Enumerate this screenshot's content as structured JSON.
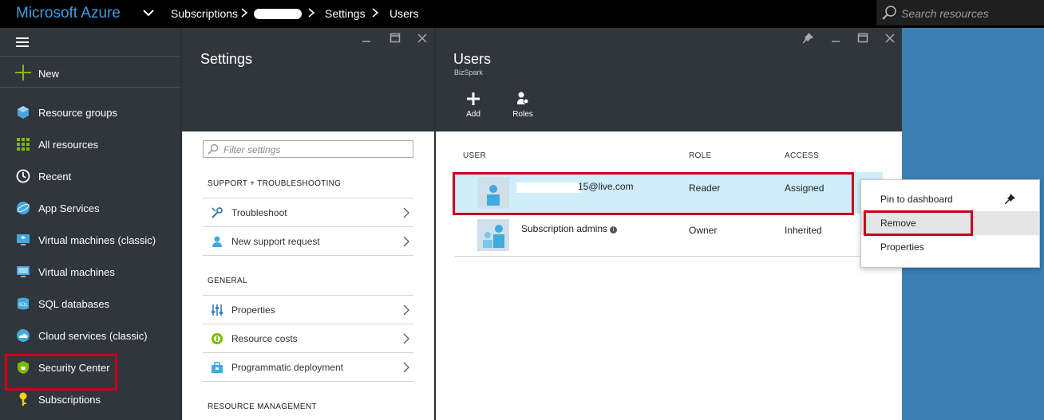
{
  "topbar": {
    "brand": "Microsoft Azure",
    "breadcrumbs": [
      "Subscriptions",
      "Settings",
      "Users"
    ],
    "search_placeholder": "Search resources"
  },
  "sidebar": {
    "new_label": "New",
    "items": [
      {
        "label": "Resource groups",
        "icon": "resource-groups-icon",
        "color": "#4aa3df"
      },
      {
        "label": "All resources",
        "icon": "all-resources-icon",
        "color": "#7fba00"
      },
      {
        "label": "Recent",
        "icon": "clock-icon",
        "color": "#ffffff"
      },
      {
        "label": "App Services",
        "icon": "globe-icon",
        "color": "#3fa9e0"
      },
      {
        "label": "Virtual machines (classic)",
        "icon": "vm-classic-icon",
        "color": "#3fa9e0"
      },
      {
        "label": "Virtual machines",
        "icon": "vm-icon",
        "color": "#3fa9e0"
      },
      {
        "label": "SQL databases",
        "icon": "sql-icon",
        "color": "#3fa9e0"
      },
      {
        "label": "Cloud services (classic)",
        "icon": "cloud-icon",
        "color": "#3fa9e0"
      },
      {
        "label": "Security Center",
        "icon": "shield-lock-icon",
        "color": "#7fba00"
      },
      {
        "label": "Subscriptions",
        "icon": "key-icon",
        "color": "#f8d20b"
      }
    ]
  },
  "settings": {
    "title": "Settings",
    "filter_placeholder": "Filter settings",
    "sections": {
      "support": "SUPPORT + TROUBLESHOOTING",
      "general": "GENERAL",
      "resource_management": "RESOURCE MANAGEMENT"
    },
    "support_items": [
      "Troubleshoot",
      "New support request"
    ],
    "general_items": [
      "Properties",
      "Resource costs",
      "Programmatic deployment"
    ]
  },
  "users": {
    "title": "Users",
    "subtitle": "BizSpark",
    "commands": {
      "add": "Add",
      "roles": "Roles"
    },
    "columns": {
      "user": "USER",
      "role": "ROLE",
      "access": "ACCESS"
    },
    "rows": [
      {
        "user": "15@live.com",
        "role": "Reader",
        "access": "Assigned"
      },
      {
        "user": "Subscription admins",
        "role": "Owner",
        "access": "Inherited"
      }
    ]
  },
  "context_menu": {
    "items": [
      "Pin to dashboard",
      "Remove",
      "Properties"
    ]
  },
  "colors": {
    "accent": "#3e9fe0",
    "highlight": "#c7001f",
    "selected_row": "#cfeefa",
    "blade_header": "#30363b"
  }
}
